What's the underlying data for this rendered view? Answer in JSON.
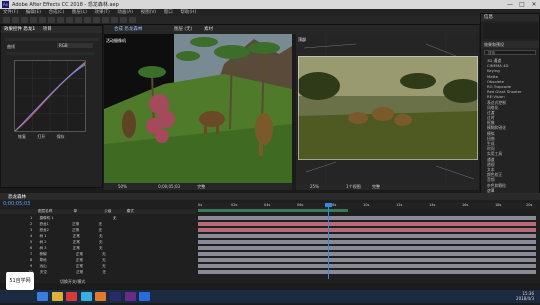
{
  "window": {
    "title": "Adobe After Effects CC 2018 - 恐龙森林.aep",
    "minimize": "—",
    "maximize": "□",
    "close": "✕"
  },
  "menu": [
    "文件(F)",
    "编辑(E)",
    "合成(C)",
    "图层(L)",
    "效果(T)",
    "动画(A)",
    "视图(V)",
    "窗口",
    "帮助(H)"
  ],
  "toolbar": {
    "workspace": "默认",
    "tools": [
      "home-icon",
      "select-icon",
      "hand-icon",
      "zoom-icon",
      "rotate-icon",
      "camera-icon",
      "pan-icon",
      "rect-icon",
      "pen-icon",
      "text-icon",
      "brush-icon",
      "clone-icon",
      "eraser-icon",
      "roto-icon",
      "puppet-icon"
    ]
  },
  "left_panel": {
    "tab1": "效果控件 恐龙1",
    "tab2": "项目",
    "label": "曲线",
    "channel": "RGB",
    "bottom_labels": [
      "恢复",
      "打开",
      "保存"
    ]
  },
  "comp_left": {
    "tab": "合成 恐龙森林",
    "tab2": "图层 (无)",
    "tab3": "素材",
    "label": "活动摄像机",
    "zoom": "50%",
    "timecode": "0;00;05;03",
    "res": "完整"
  },
  "comp_right": {
    "label": "顶部",
    "zoom": "25%",
    "view": "1个视图",
    "res": "完整"
  },
  "right_panel": {
    "tab": "效果和预设",
    "info_tab": "信息",
    "search_placeholder": "搜索",
    "items": [
      "3D 通道",
      "CINEMA 4D",
      "Keying",
      "Matte",
      "Obsolete",
      "RG Trapcode",
      "Red Giant Shooter",
      "RE:Vision",
      "表达式控制",
      "风格化",
      "过渡",
      "过时",
      "抠像",
      "模糊和锐化",
      "模拟",
      "扭曲",
      "生成",
      "时间",
      "实用工具",
      "通道",
      "透视",
      "文本",
      "颜色校正",
      "音频",
      "杂色和颗粒",
      "遮罩",
      "Shine",
      "Video Copilot"
    ]
  },
  "timeline": {
    "tab": "恐龙森林",
    "timecode": "0;00;05;03",
    "columns": [
      "图层名称",
      "单",
      "父级",
      "模式",
      "TrkMat"
    ],
    "rulers": [
      "0s",
      "02s",
      "04s",
      "06s",
      "08s",
      "10s",
      "12s",
      "14s",
      "16s",
      "18s",
      "20s"
    ],
    "layers": [
      {
        "num": "1",
        "name": "摄像机 1",
        "mode": "",
        "parent": "无"
      },
      {
        "num": "2",
        "name": "恐龙1",
        "mode": "正常",
        "parent": "无"
      },
      {
        "num": "3",
        "name": "恐龙2",
        "mode": "正常",
        "parent": "无"
      },
      {
        "num": "4",
        "name": "树 1",
        "mode": "正常",
        "parent": "无"
      },
      {
        "num": "5",
        "name": "树 2",
        "mode": "正常",
        "parent": "无"
      },
      {
        "num": "6",
        "name": "树 3",
        "mode": "正常",
        "parent": "无"
      },
      {
        "num": "7",
        "name": "棕榈",
        "mode": "正常",
        "parent": "无"
      },
      {
        "num": "8",
        "name": "草地",
        "mode": "正常",
        "parent": "无"
      },
      {
        "num": "9",
        "name": "远山",
        "mode": "正常",
        "parent": "无"
      },
      {
        "num": "10",
        "name": "天空",
        "mode": "正常",
        "parent": "无"
      }
    ],
    "footer": "切换开关/模式"
  },
  "taskbar": {
    "clock": "15:36",
    "date": "2018/4/3",
    "watermark": "51自学网"
  },
  "colors": {
    "accent": "#2d8ceb",
    "track_red": "#b46a78",
    "track_gray": "#8a8a96"
  }
}
